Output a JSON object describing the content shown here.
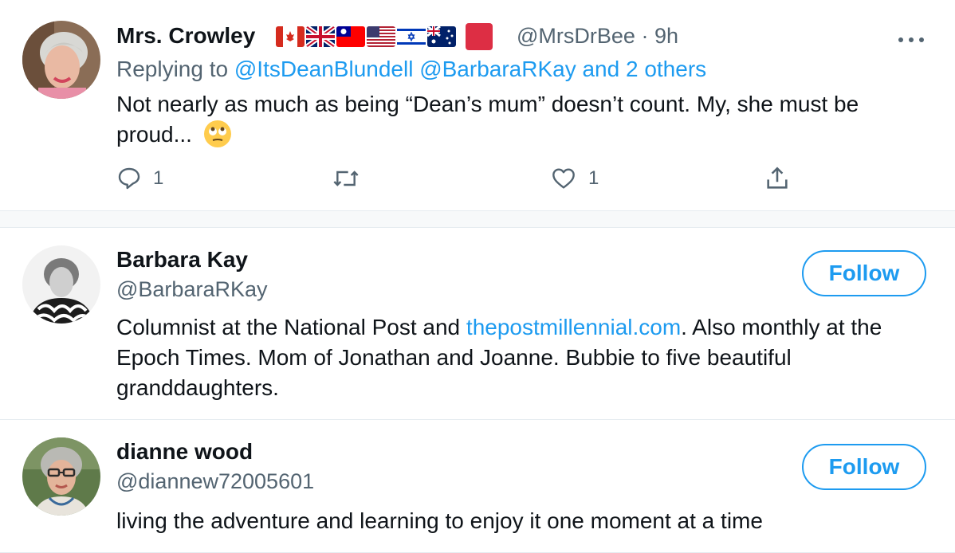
{
  "tweet": {
    "author_name": "Mrs. Crowley",
    "author_handle": "@MrsDrBee",
    "separator": "·",
    "time": "9h",
    "more_icon": "more-horizontal-icon",
    "reply_prefix": "Replying to",
    "reply_targets": "@ItsDeanBlundell @BarbaraRKay and 2 others",
    "text": "Not nearly as much as being “Dean’s mum” doesn’t count. My, she must be proud...",
    "emoji": "face-with-rolling-eyes",
    "flags": [
      "canada-flag",
      "uk-flag",
      "taiwan-flag",
      "usa-flag",
      "israel-flag",
      "australia-flag",
      "red-square"
    ],
    "reply_count": "1",
    "retweet_count": "",
    "like_count": "1"
  },
  "users": [
    {
      "name": "Barbara Kay",
      "handle": "@BarbaraRKay",
      "follow_label": "Follow",
      "bio_before_link": "Columnist at the National Post and ",
      "bio_link": "thepostmillennial.com",
      "bio_after_link": ". Also monthly at the Epoch Times. Mom of Jonathan and Joanne. Bubbie to five beautiful granddaughters."
    },
    {
      "name": "dianne wood",
      "handle": "@diannew72005601",
      "follow_label": "Follow",
      "bio": "living the adventure and learning to enjoy it one moment at a time"
    }
  ],
  "colors": {
    "accent": "#1d9bf0",
    "secondary_text": "#536471",
    "divider": "#e6ecf0"
  }
}
